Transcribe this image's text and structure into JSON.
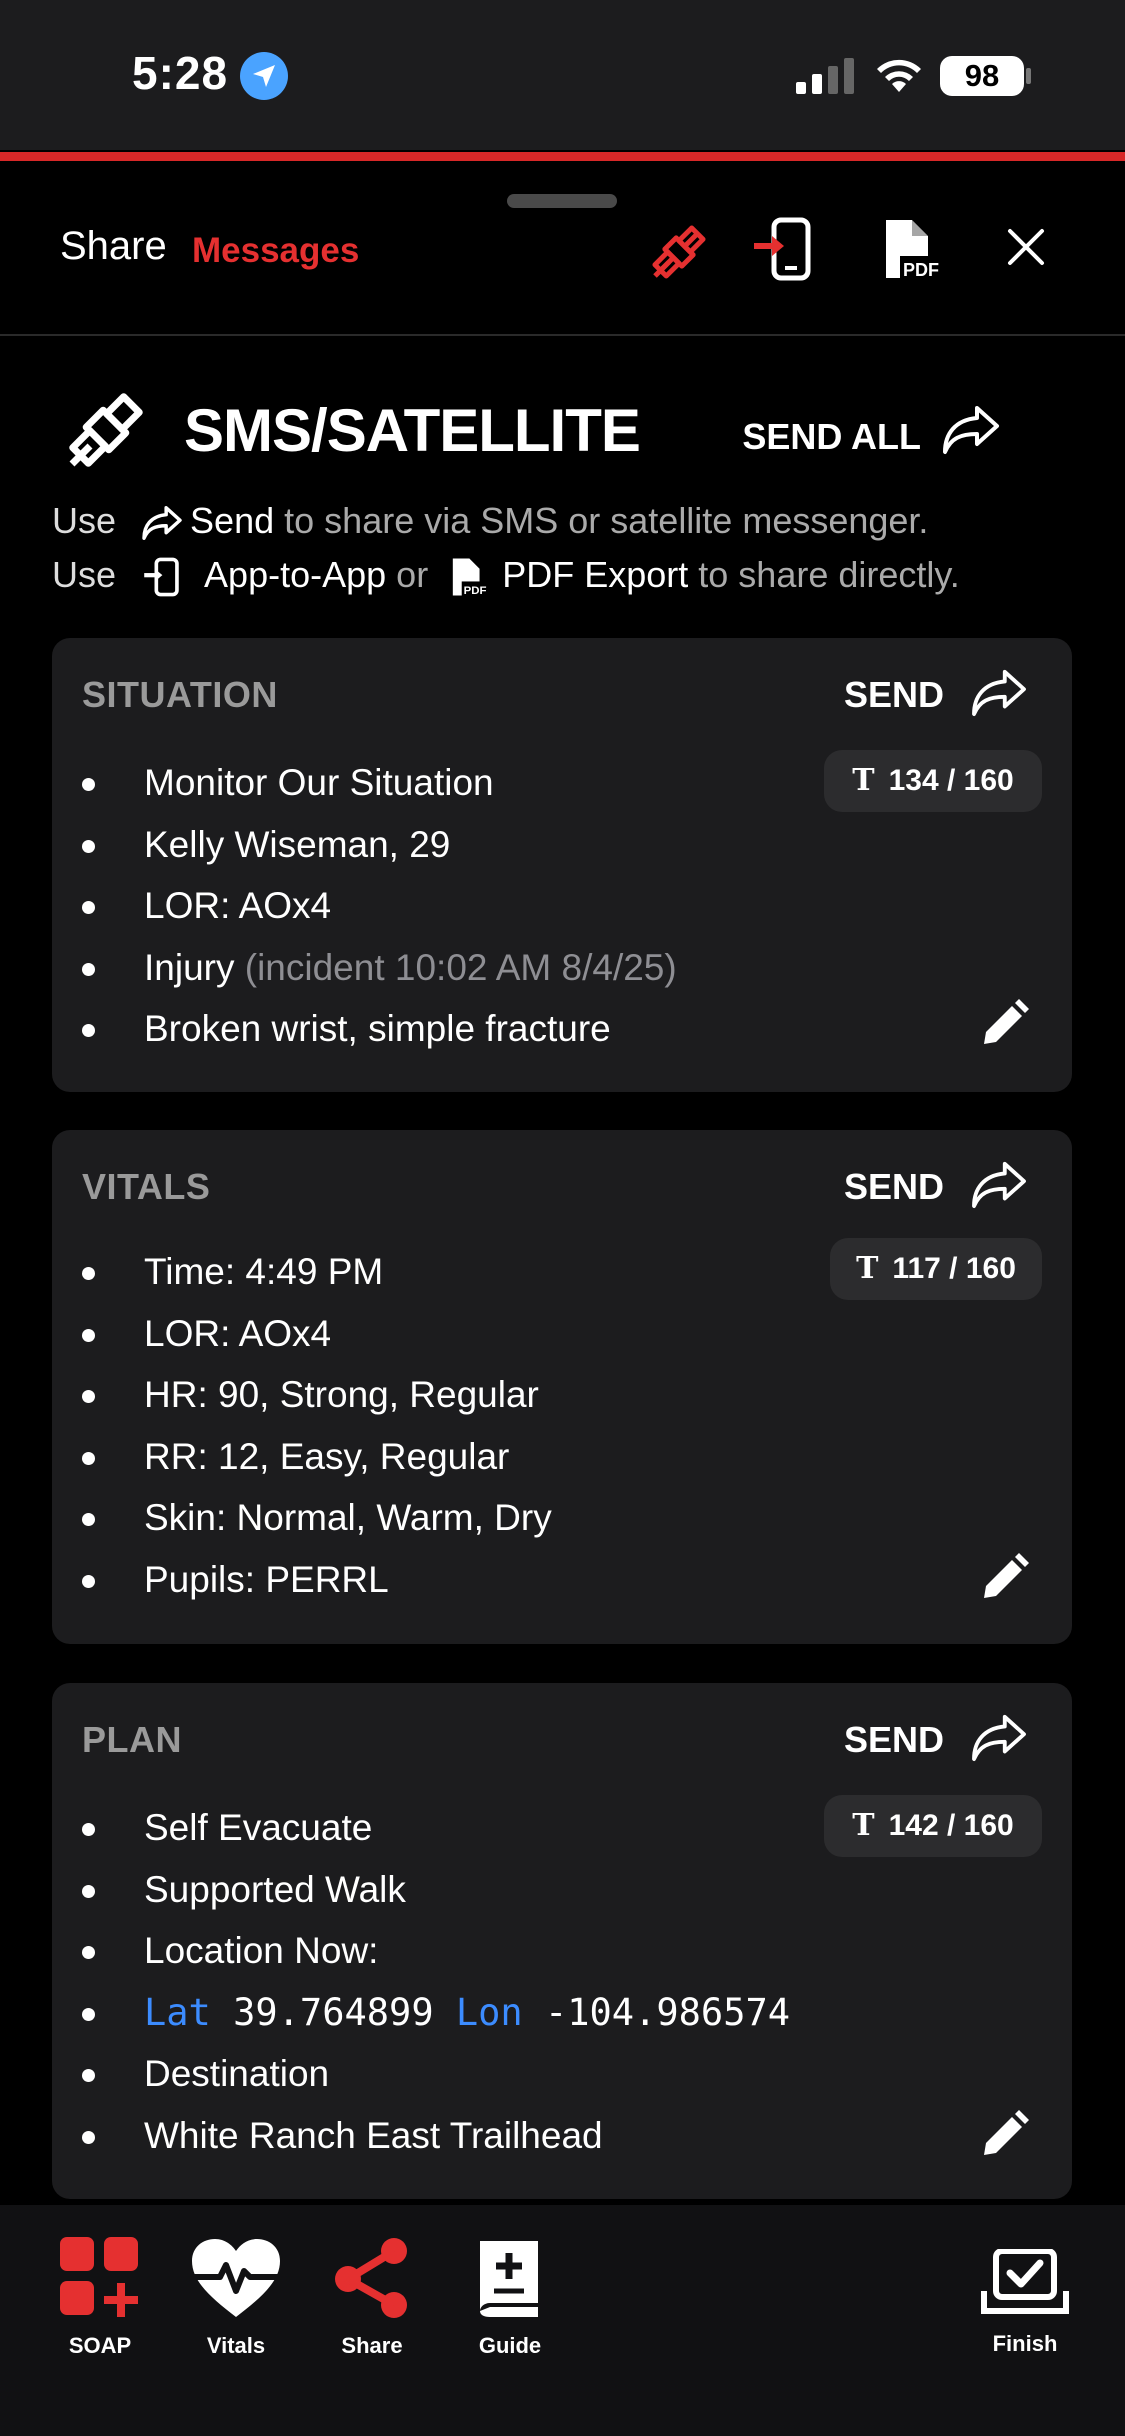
{
  "status_bar": {
    "time": "5:28",
    "battery": "98"
  },
  "header": {
    "share_label": "Share",
    "app_name": "Messages",
    "icons": [
      "satellite-icon",
      "app-to-app-icon",
      "pdf-export-icon",
      "close-icon"
    ]
  },
  "title": {
    "text": "SMS/SATELLITE",
    "send_all": "SEND ALL"
  },
  "help": {
    "line1_use": "Use",
    "line1_send": "Send",
    "line1_rest": "to share via SMS or satellite messenger.",
    "line2_use": "Use",
    "line2_app": "App-to-App",
    "line2_or": "or",
    "line2_pdf": "PDF Export",
    "line2_rest": "to share directly."
  },
  "colors": {
    "accent": "#e53030",
    "card": "#1c1c1e",
    "link_blue": "#3c8cff"
  },
  "cards": [
    {
      "title": "SITUATION",
      "send": "SEND",
      "count": "134 / 160",
      "items": [
        "Monitor Our Situation",
        "Kelly Wiseman, 29",
        "LOR: AOx4",
        "Injury",
        "Broken wrist, simple fracture"
      ],
      "injury_note": "(incident 10:02 AM 8/4/25)"
    },
    {
      "title": "VITALS",
      "send": "SEND",
      "count": "117 / 160",
      "items": [
        "Time: 4:49 PM",
        "LOR: AOx4",
        "HR: 90, Strong, Regular",
        "RR: 12, Easy, Regular",
        "Skin: Normal, Warm, Dry",
        "Pupils: PERRL"
      ]
    },
    {
      "title": "PLAN",
      "send": "SEND",
      "count": "142 / 160",
      "items": [
        "Self Evacuate",
        "Supported Walk",
        "Location Now:",
        "",
        "Destination",
        "White Ranch East Trailhead"
      ],
      "lat_label": "Lat",
      "lat": "39.764899",
      "lon_label": "Lon",
      "lon": "-104.986574"
    }
  ],
  "tabs": [
    {
      "label": "SOAP",
      "icon": "soap-grid-icon"
    },
    {
      "label": "Vitals",
      "icon": "heart-pulse-icon"
    },
    {
      "label": "Share",
      "icon": "share-icon"
    },
    {
      "label": "Guide",
      "icon": "guide-book-icon"
    },
    {
      "label": "Finish",
      "icon": "finish-check-icon"
    }
  ]
}
